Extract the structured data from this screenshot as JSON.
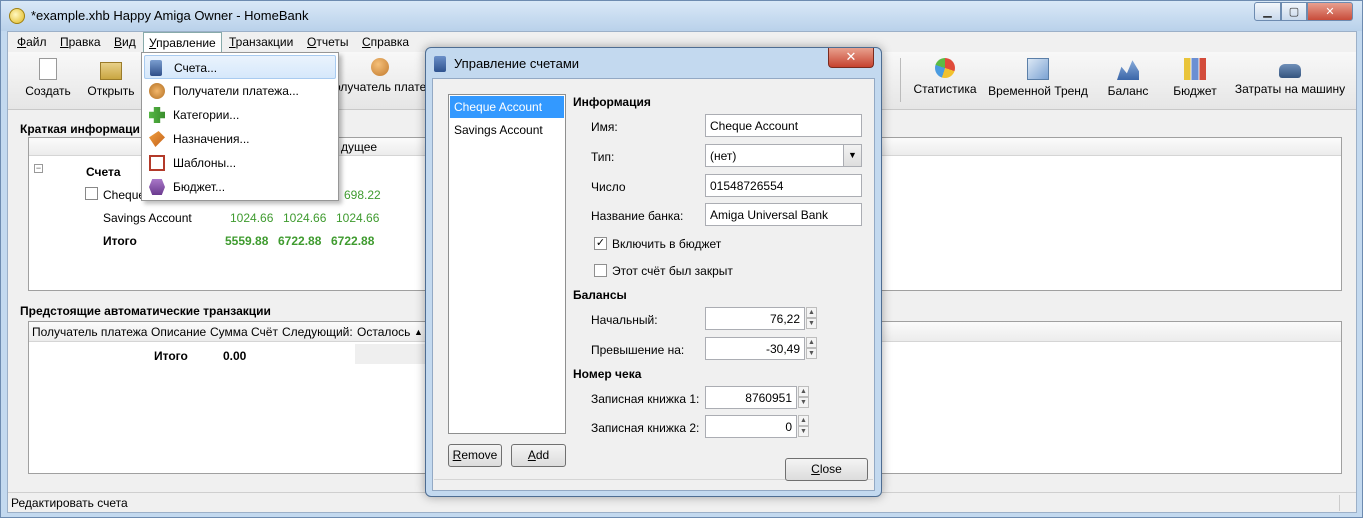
{
  "window": {
    "title": "*example.xhb Happy Amiga Owner - HomeBank"
  },
  "menubar": [
    {
      "label": "Файл",
      "u": "Ф",
      "rest": "айл"
    },
    {
      "label": "Правка",
      "u": "П",
      "rest": "равка"
    },
    {
      "label": "Вид",
      "u": "В",
      "rest": "ид"
    },
    {
      "label": "Управление",
      "u": "У",
      "rest": "правление"
    },
    {
      "label": "Транзакции",
      "u": "Т",
      "rest": "ранзакции"
    },
    {
      "label": "Отчеты",
      "u": "О",
      "rest": "тчеты"
    },
    {
      "label": "Справка",
      "u": "С",
      "rest": "правка"
    }
  ],
  "toolbar": {
    "create": "Создать",
    "open": "Открыть",
    "payee": "олучатель плате",
    "statistics": "Статистика",
    "trend": "Временной Тренд",
    "balance": "Баланс",
    "budget": "Бюджет",
    "car": "Затраты на машину"
  },
  "dropdown": [
    "Счета...",
    "Получатели платежа...",
    "Категории...",
    "Назначения...",
    "Шаблоны...",
    "Бюджет..."
  ],
  "summary": {
    "label": "Краткая информаци",
    "col_future": "дущее",
    "accounts_label": "Счета",
    "rows": [
      {
        "name": "Cheque",
        "v3": "698.22"
      },
      {
        "name": "Savings Account",
        "v1": "1024.66",
        "v2": "1024.66",
        "v3": "1024.66"
      }
    ],
    "total": {
      "name": "Итого",
      "v1": "5559.88",
      "v2": "6722.88",
      "v3": "6722.88"
    }
  },
  "scheduled": {
    "label": "Предстоящие автоматические транзакции",
    "headers": [
      "Получатель платежа",
      "Описание",
      "Сумма",
      "Счёт",
      "Следующий:",
      "Осталось"
    ],
    "total_label": "Итого",
    "total_value": "0.00"
  },
  "status": {
    "text": "Редактировать счета"
  },
  "dialog": {
    "title": "Управление счетами",
    "accounts": [
      "Cheque Account",
      "Savings Account"
    ],
    "remove": "Remove",
    "add": "Add",
    "close": "Close",
    "info": {
      "section": "Информация",
      "name_label": "Имя:",
      "name_value": "Cheque Account",
      "type_label": "Тип:",
      "type_value": "(нет)",
      "number_label": "Число",
      "number_value": "01548726554",
      "bank_label": "Название банка:",
      "bank_value": "Amiga Universal Bank",
      "budget_check": "Включить в бюджет",
      "closed_check": "Этот счёт был закрыт"
    },
    "balances": {
      "section": "Балансы",
      "initial_label": "Начальный:",
      "initial_value": "76,22",
      "overdraft_label": "Превышение на:",
      "overdraft_value": "-30,49"
    },
    "cheque": {
      "section": "Номер чека",
      "book1_label": "Записная книжка 1:",
      "book1_value": "8760951",
      "book2_label": "Записная книжка 2:",
      "book2_value": "0"
    }
  }
}
